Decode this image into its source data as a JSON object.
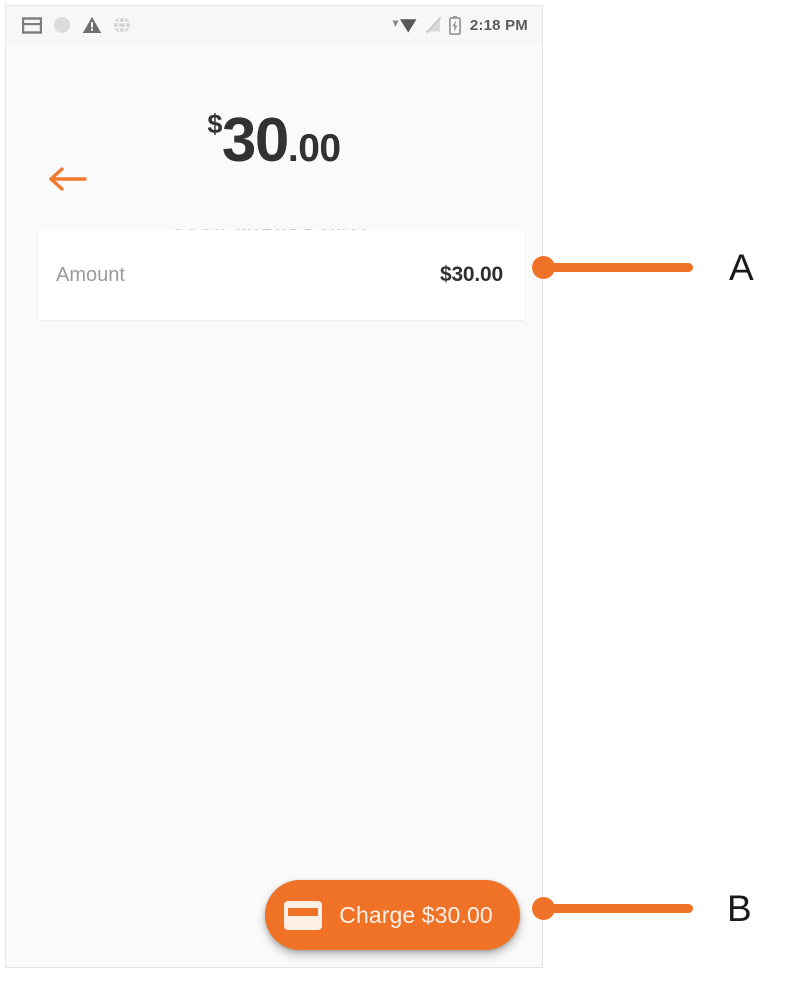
{
  "screen": {
    "background_color": "#fafafa",
    "accent_color": "#ef7226"
  },
  "status_bar": {
    "clock": "2:18 PM",
    "left_icons": [
      {
        "name": "card-reader-icon"
      },
      {
        "name": "circle-icon"
      },
      {
        "name": "warning-triangle-icon"
      },
      {
        "name": "sync-globe-icon"
      }
    ],
    "right_icons": [
      {
        "name": "wifi-icon"
      },
      {
        "name": "no-signal-icon"
      },
      {
        "name": "battery-charging-icon"
      }
    ]
  },
  "header": {
    "back_icon": "back-arrow-icon",
    "currency_symbol": "$",
    "amount_whole": "30",
    "amount_cents": ".00",
    "subtitle": "CASH WITHDRAWAL"
  },
  "amount_row": {
    "label": "Amount",
    "value": "$30.00"
  },
  "charge_button": {
    "icon": "credit-card-icon",
    "label": "Charge $30.00"
  },
  "callouts": [
    {
      "id": "A",
      "label": "A",
      "target": "amount-row"
    },
    {
      "id": "B",
      "label": "B",
      "target": "charge-button"
    }
  ]
}
